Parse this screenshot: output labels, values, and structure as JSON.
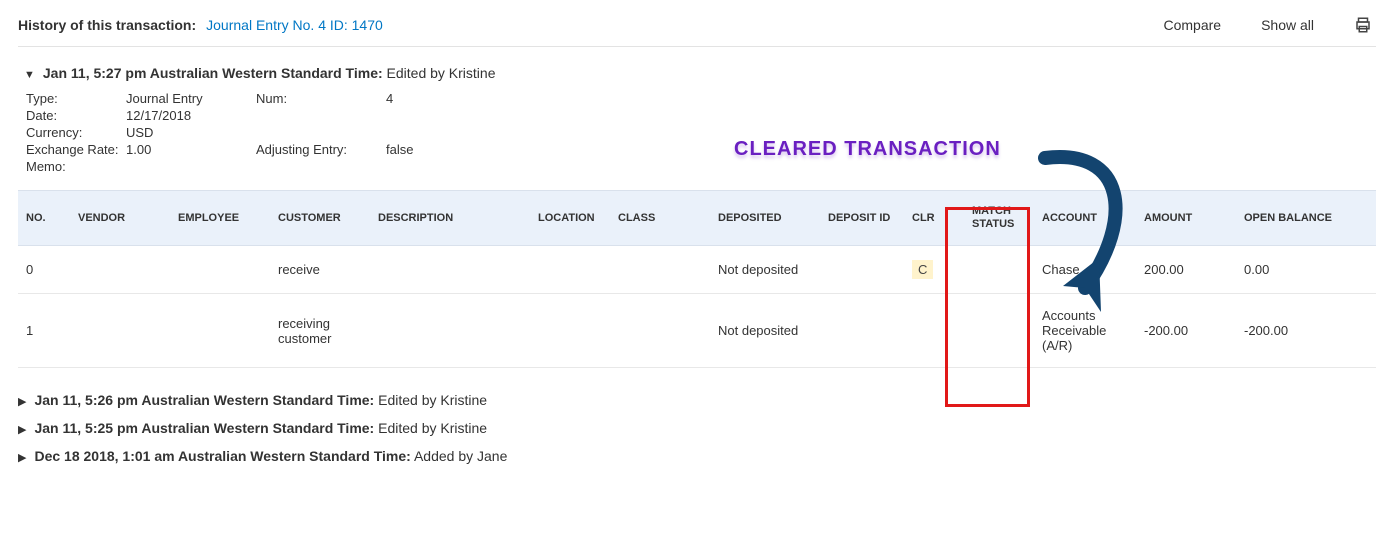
{
  "header": {
    "title": "History of this transaction:",
    "link": "Journal Entry No. 4 ID: 1470",
    "compare": "Compare",
    "show_all": "Show all"
  },
  "expanded": {
    "timestamp": "Jan 11, 5:27 pm Australian Western Standard Time:",
    "action": "Edited by Kristine"
  },
  "meta": {
    "type_label": "Type:",
    "type": "Journal Entry",
    "num_label": "Num:",
    "num": "4",
    "date_label": "Date:",
    "date": "12/17/2018",
    "currency_label": "Currency:",
    "currency": "USD",
    "exchange_label": "Exchange Rate:",
    "exchange": "1.00",
    "adjusting_label": "Adjusting Entry:",
    "adjusting": "false",
    "memo_label": "Memo:"
  },
  "th": {
    "no": "NO.",
    "vendor": "VENDOR",
    "employee": "EMPLOYEE",
    "customer": "CUSTOMER",
    "description": "DESCRIPTION",
    "location": "LOCATION",
    "class": "CLASS",
    "deposited": "DEPOSITED",
    "deposit_id": "DEPOSIT ID",
    "clr": "CLR",
    "match_status": "MATCH STATUS",
    "account": "ACCOUNT",
    "amount": "AMOUNT",
    "open_balance": "OPEN BALANCE"
  },
  "rows": [
    {
      "no": "0",
      "customer": "receive",
      "deposited": "Not deposited",
      "clr": "C",
      "account": "Chase",
      "amount": "200.00",
      "open_balance": "0.00"
    },
    {
      "no": "1",
      "customer": "receiving customer",
      "deposited": "Not deposited",
      "clr": "",
      "account": "Accounts Receivable (A/R)",
      "amount": "-200.00",
      "open_balance": "-200.00"
    }
  ],
  "history": [
    {
      "ts": "Jan 11, 5:26 pm Australian Western Standard Time:",
      "act": "Edited by Kristine"
    },
    {
      "ts": "Jan 11, 5:25 pm Australian Western Standard Time:",
      "act": "Edited by Kristine"
    },
    {
      "ts": "Dec 18 2018, 1:01 am Australian Western Standard Time:",
      "act": "Added by Jane"
    }
  ],
  "annotation": "CLEARED TRANSACTION"
}
